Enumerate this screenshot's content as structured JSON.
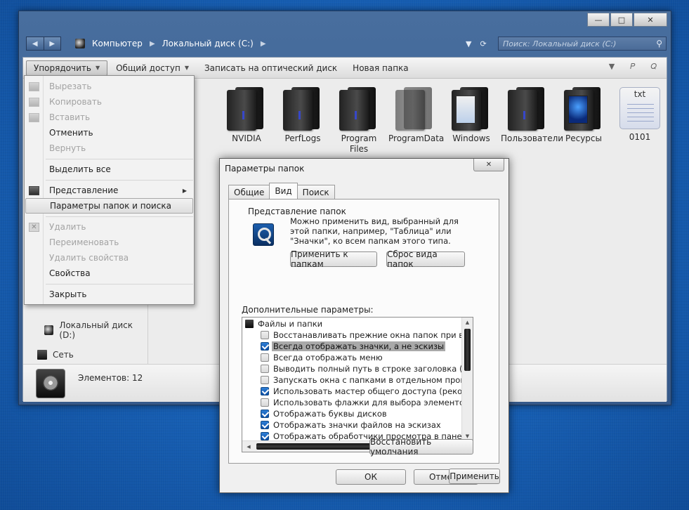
{
  "window": {
    "caption_buttons": {
      "minimize": "—",
      "maximize": "□",
      "close": "✕"
    }
  },
  "address_bar": {
    "crumbs": [
      "Компьютер",
      "Локальный диск (C:)"
    ],
    "search_placeholder": "Поиск: Локальный диск (C:)"
  },
  "toolbar": {
    "organize": "Упорядочить",
    "share": "Общий доступ",
    "burn": "Записать на оптический диск",
    "new_folder": "Новая папка"
  },
  "files": [
    {
      "name": "NVIDIA",
      "icon": "folder"
    },
    {
      "name": "PerfLogs",
      "icon": "folder"
    },
    {
      "name": "Program Files",
      "icon": "folder"
    },
    {
      "name": "ProgramData",
      "icon": "folder-dim"
    },
    {
      "name": "Windows",
      "icon": "folder-windows"
    },
    {
      "name": "Пользователи",
      "icon": "folder"
    },
    {
      "name": "Ресурсы",
      "icon": "folder-resources"
    },
    {
      "name": "0101",
      "icon": "txt-file"
    }
  ],
  "txt_icon_label": "txt",
  "nav": {
    "drive_d": "Локальный диск (D:)",
    "network": "Сеть"
  },
  "details": {
    "items_count": "Элементов: 12"
  },
  "menu": {
    "cut": "Вырезать",
    "copy": "Копировать",
    "paste": "Вставить",
    "undo": "Отменить",
    "redo": "Вернуть",
    "select_all": "Выделить все",
    "layout": "Представление",
    "folder_options": "Параметры папок и поиска",
    "delete": "Удалить",
    "rename": "Переименовать",
    "remove_properties": "Удалить свойства",
    "properties": "Свойства",
    "close": "Закрыть"
  },
  "dialog": {
    "title": "Параметры папок",
    "tabs": [
      "Общие",
      "Вид",
      "Поиск"
    ],
    "active_tab": "Вид",
    "folder_views_title": "Представление папок",
    "folder_views_desc": "Можно применить вид, выбранный для этой папки, например, \"Таблица\" или \"Значки\", ко всем папкам этого типа.",
    "apply_to_folders": "Применить к папкам",
    "reset_folders": "Сброс вида папок",
    "advanced_title": "Дополнительные параметры:",
    "tree_root": "Файлы и папки",
    "options": [
      {
        "label": "Восстанавливать прежние окна папок при входе в",
        "checked": false,
        "selected": false
      },
      {
        "label": "Всегда отображать значки, а не эскизы",
        "checked": true,
        "selected": true
      },
      {
        "label": "Всегда отображать меню",
        "checked": false,
        "selected": false
      },
      {
        "label": "Выводить полный путь в строке заголовка (только",
        "checked": false,
        "selected": false
      },
      {
        "label": "Запускать окна с папками в отдельном процессе",
        "checked": false,
        "selected": false
      },
      {
        "label": "Использовать мастер общего доступа (рекомендуе",
        "checked": true,
        "selected": false
      },
      {
        "label": "Использовать флажки для выбора элементов",
        "checked": false,
        "selected": false
      },
      {
        "label": "Отображать буквы дисков",
        "checked": true,
        "selected": false
      },
      {
        "label": "Отображать значки файлов на эскизах",
        "checked": true,
        "selected": false
      },
      {
        "label": "Отображать обработчики просмотра в панели пр",
        "checked": true,
        "selected": false
      }
    ],
    "restore_defaults": "Восстановить умолчания",
    "ok": "ОК",
    "cancel": "Отмена",
    "apply": "Применить"
  }
}
